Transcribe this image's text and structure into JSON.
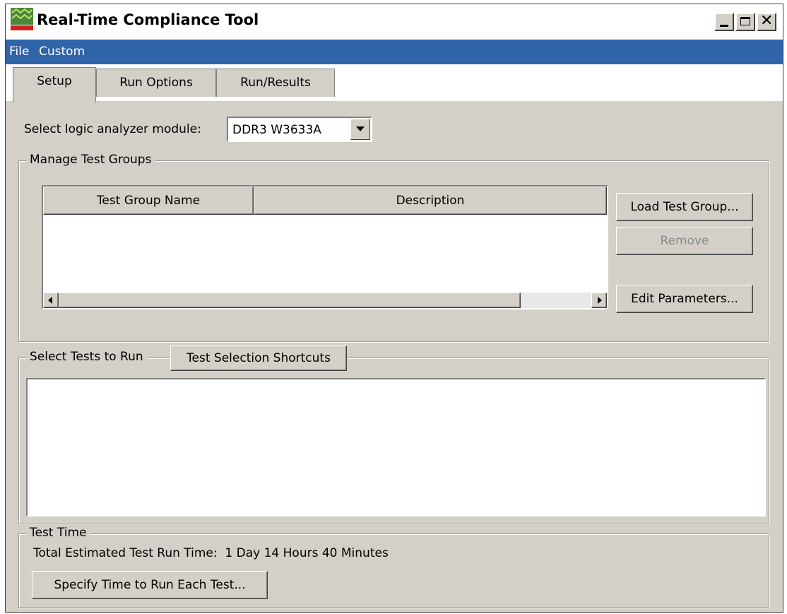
{
  "window": {
    "title": "Real-Time Compliance Tool",
    "controls": {
      "minimize": "_",
      "maximize": "□",
      "close": "×"
    }
  },
  "menu": {
    "items": [
      "File",
      "Custom"
    ]
  },
  "tabs": [
    {
      "label": "Setup",
      "active": true
    },
    {
      "label": "Run Options",
      "active": false
    },
    {
      "label": "Run/Results",
      "active": false
    }
  ],
  "setup": {
    "module_label": "Select logic analyzer module:",
    "module_value": "DDR3 W3633A"
  },
  "manage_groups": {
    "title": "Manage Test Groups",
    "columns": [
      "Test Group Name",
      "Description"
    ],
    "rows": [],
    "buttons": {
      "load": "Load Test Group...",
      "remove": "Remove",
      "edit": "Edit Parameters..."
    }
  },
  "select_tests": {
    "title": "Select Tests to Run",
    "shortcuts_button": "Test Selection Shortcuts"
  },
  "test_time": {
    "title": "Test Time",
    "estimate_text": "Total Estimated Test Run Time:  1 Day 14 Hours 40 Minutes",
    "specify_button": "Specify Time to Run Each Test..."
  },
  "colors": {
    "menubar": "#2f64a8",
    "face": "#d4d0c8"
  }
}
